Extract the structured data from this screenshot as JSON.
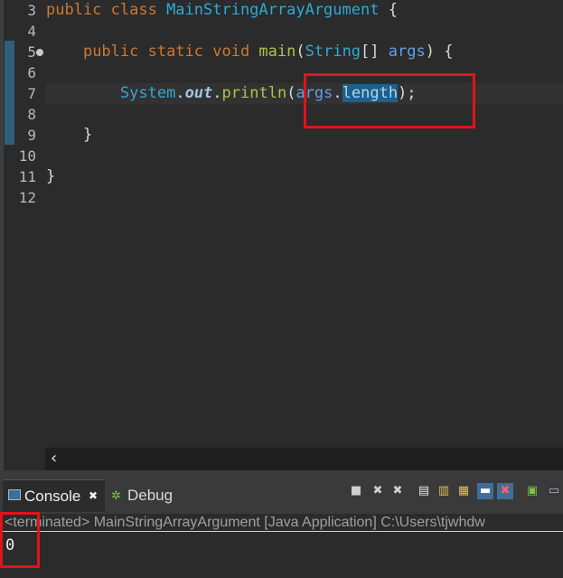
{
  "editor": {
    "lines": [
      {
        "num": "3",
        "tokens": [
          [
            "kw",
            "public class "
          ],
          [
            "cls",
            "MainStringArrayArgument"
          ],
          [
            "plain",
            " {"
          ]
        ]
      },
      {
        "num": "4",
        "tokens": []
      },
      {
        "num": "5",
        "tokens": [
          [
            "plain",
            "    "
          ],
          [
            "kw",
            "public static void "
          ],
          [
            "mth",
            "main"
          ],
          [
            "plain",
            "("
          ],
          [
            "cls",
            "String"
          ],
          [
            "plain",
            "[] "
          ],
          [
            "param",
            "args"
          ],
          [
            "plain",
            ") {"
          ]
        ]
      },
      {
        "num": "6",
        "tokens": []
      },
      {
        "num": "7",
        "tokens": [
          [
            "plain",
            "        "
          ],
          [
            "cls",
            "System"
          ],
          [
            "plain",
            "."
          ],
          [
            "static-fld",
            "out"
          ],
          [
            "plain",
            "."
          ],
          [
            "mth",
            "println"
          ],
          [
            "plain",
            "("
          ],
          [
            "param",
            "args"
          ],
          [
            "plain",
            "."
          ],
          [
            "sel",
            "length"
          ],
          [
            "plain",
            ");"
          ]
        ]
      },
      {
        "num": "8",
        "tokens": []
      },
      {
        "num": "9",
        "tokens": [
          [
            "plain",
            "    }"
          ]
        ]
      },
      {
        "num": "10",
        "tokens": []
      },
      {
        "num": "11",
        "tokens": [
          [
            "plain",
            "}"
          ]
        ]
      },
      {
        "num": "12",
        "tokens": []
      }
    ],
    "scroll_left_icon": "‹"
  },
  "console": {
    "tabs": [
      {
        "label": "Console",
        "icon": "console-icon",
        "close": "✖"
      },
      {
        "label": "Debug",
        "icon": "debug-icon"
      }
    ],
    "header": "<terminated> MainStringArrayArgument [Java Application] C:\\Users\\tjwhdw",
    "output": "0"
  },
  "colors": {
    "editor_bg": "#2b2b2b",
    "keyword": "#cc7832",
    "class": "#2ea9d6",
    "method": "#a8c54b",
    "highlight_box": "#e0141a"
  }
}
